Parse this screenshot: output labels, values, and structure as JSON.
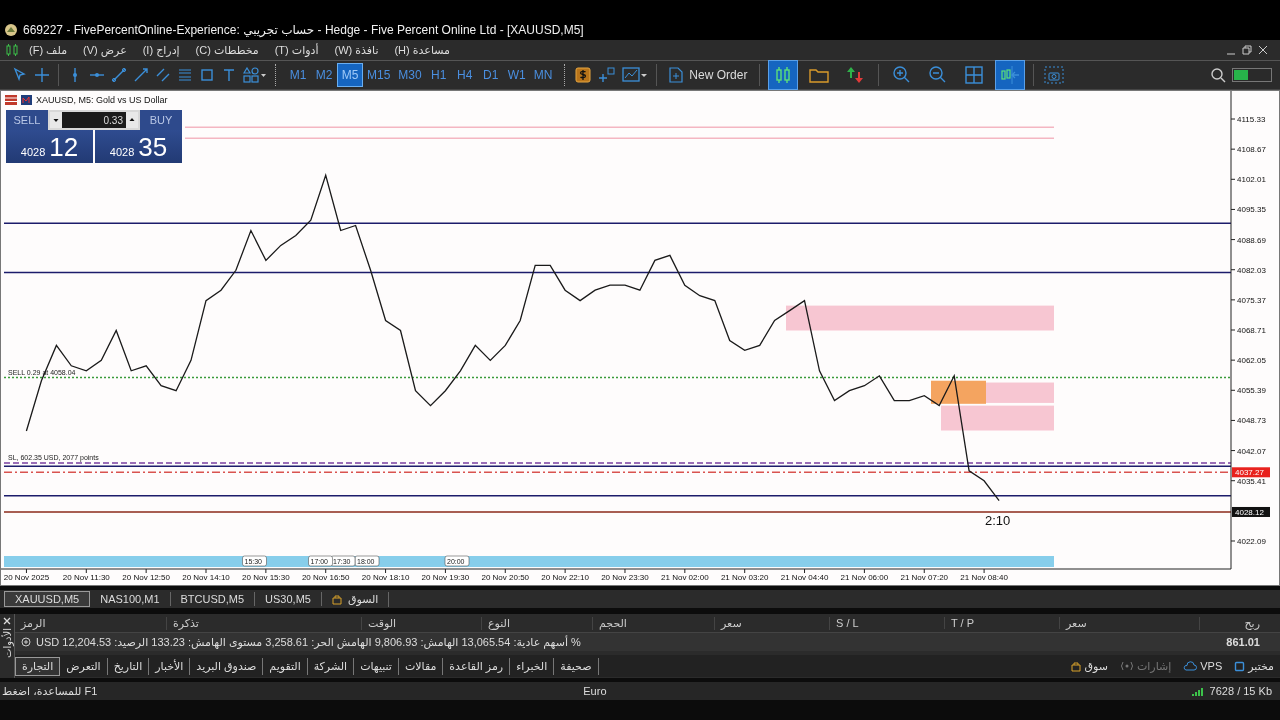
{
  "window": {
    "title": "669227 - FivePercentOnline-Experience: حساب تجريبي - Hedge - Five Percent Online Ltd - [XAUUSD,M5]"
  },
  "menu": [
    "(H) مساعدة",
    "(W) نافذة",
    "(T) أدوات",
    "(C) مخططات",
    "(I) إدراج",
    "(V) عرض",
    "(F) ملف"
  ],
  "timeframes": [
    {
      "label": "MN",
      "selected": false
    },
    {
      "label": "W1",
      "selected": false
    },
    {
      "label": "D1",
      "selected": false
    },
    {
      "label": "H4",
      "selected": false
    },
    {
      "label": "H1",
      "selected": false
    },
    {
      "label": "M30",
      "selected": false
    },
    {
      "label": "M15",
      "selected": false
    },
    {
      "label": "M5",
      "selected": true
    },
    {
      "label": "M2",
      "selected": false
    },
    {
      "label": "M1",
      "selected": false
    }
  ],
  "new_order": "New Order",
  "chart_toggles": [
    {
      "kind": "candles",
      "selected": true
    },
    {
      "kind": "folder",
      "selected": false
    },
    {
      "kind": "trade-arrows",
      "selected": false
    }
  ],
  "view_toggles": [
    {
      "kind": "zoom-in",
      "selected": false
    },
    {
      "kind": "zoom-out",
      "selected": false
    },
    {
      "kind": "tile",
      "selected": false
    },
    {
      "kind": "chart-shift",
      "selected": true
    }
  ],
  "chart": {
    "header": "XAUUSD, M5:  Gold vs US Dollar",
    "one_click": {
      "sell": "SELL",
      "buy": "BUY",
      "lot": "0.33",
      "sell_price_small": "4028",
      "sell_price_big": "12",
      "buy_price_small": "4028",
      "buy_price_big": "35"
    },
    "order_labels": [
      "SELL 0.29 at 4058.04",
      "SL, 602.35 USD, 2077 points"
    ],
    "price_tags": [
      {
        "kind": "stop",
        "text": "4037.27"
      },
      {
        "kind": "bid",
        "text": "4028.12"
      }
    ],
    "timer": "2:10",
    "sessions": [
      "20:00",
      "18:00",
      "17:30",
      "17:00",
      "15:30"
    ],
    "chart_data": {
      "type": "line",
      "ylim": [
        4015.9,
        4121.3
      ],
      "categories": [
        null,
        "20 Nov 2025",
        null,
        null,
        null,
        "20 Nov 11:30",
        null,
        null,
        null,
        "20 Nov 12:50",
        null,
        null,
        null,
        "20 Nov 14:10",
        null,
        null,
        null,
        "20 Nov 15:30",
        null,
        null,
        null,
        "20 Nov 16:50",
        null,
        null,
        null,
        "20 Nov 18:10",
        null,
        null,
        null,
        "20 Nov 19:30",
        null,
        null,
        null,
        "20 Nov 20:50",
        null,
        null,
        null,
        "20 Nov 22:10",
        null,
        null,
        null,
        "20 Nov 23:30",
        null,
        null,
        null,
        "21 Nov 02:00",
        null,
        null,
        null,
        "21 Nov 03:20",
        null,
        null,
        null,
        "21 Nov 04:40",
        null,
        null,
        null,
        "21 Nov 06:00",
        null,
        null,
        null,
        "21 Nov 07:20",
        null,
        null,
        null,
        "21 Nov 08:40",
        null,
        null,
        null,
        null,
        null,
        null,
        null,
        null,
        null,
        null,
        null,
        null,
        null,
        null,
        null,
        null
      ],
      "series": [
        {
          "color": "#1a1a1a",
          "values": [
            null,
            4046.4,
            4057.5,
            4065.3,
            4060.8,
            4059.7,
            4062.0,
            4068.6,
            4059.7,
            4060.8,
            4056.4,
            4055.3,
            4062.0,
            4075.2,
            4077.5,
            4081.9,
            4090.7,
            4084.1,
            4087.4,
            4089.6,
            4093.0,
            4102.9,
            4090.7,
            4091.8,
            4081.9,
            4070.8,
            4068.6,
            4055.3,
            4052.0,
            4055.3,
            4059.7,
            4065.3,
            4062.0,
            4065.3,
            4070.8,
            4083.0,
            4083.0,
            4077.5,
            4075.2,
            4077.5,
            4078.6,
            4078.6,
            4077.5,
            4084.1,
            4085.2,
            4078.6,
            4076.3,
            4075.2,
            4066.4,
            4064.2,
            4065.3,
            4070.8,
            4073.0,
            4075.2,
            4059.7,
            4053.1,
            4055.3,
            4056.4,
            4058.6,
            4053.1,
            4053.1,
            4054.2,
            4052.0,
            4058.6,
            4037.6,
            4035.4,
            4031.0,
            null,
            null,
            null,
            null,
            null,
            null,
            null,
            null,
            null,
            null,
            null,
            null,
            null,
            null,
            null
          ]
        }
      ],
      "yticks": [
        4115.33,
        4108.67,
        4102.01,
        4095.35,
        4088.69,
        4082.03,
        4075.37,
        4068.71,
        4062.05,
        4055.39,
        4048.73,
        4042.07,
        4035.41,
        4022.09
      ]
    }
  },
  "chart_tabs": [
    {
      "label": "السوق",
      "selected": false
    },
    {
      "label": "US30,M5",
      "selected": false
    },
    {
      "label": "BTCUSD,M5",
      "selected": false
    },
    {
      "label": "NAS100,M1",
      "selected": false
    },
    {
      "label": "XAUUSD,M5",
      "selected": true
    }
  ],
  "terminal": {
    "toolbox_label": "الأدوات",
    "columns": [
      "ربح",
      "سعر",
      "T / P",
      "S / L",
      "سعر",
      "الحجم",
      "النوع",
      "الوقت",
      "تذكرة",
      "الرمز"
    ],
    "summary": "% أسهم عادية: 13,065.54  الهامش: 9,806.93  الهامش الحر: 3,258.61  مستوى الهامش: 133.23  الرصيد: 12,204.53 USD",
    "profit": "861.01",
    "tabs": [
      {
        "label": "صحيفة",
        "selected": false
      },
      {
        "label": "الخبراء",
        "selected": false
      },
      {
        "label": "رمز القاعدة",
        "selected": false
      },
      {
        "label": "مقالات",
        "selected": false
      },
      {
        "label": "تنبيهات",
        "selected": false
      },
      {
        "label": "الشركة",
        "selected": false
      },
      {
        "label": "التقويم",
        "selected": false
      },
      {
        "label": "صندوق البريد",
        "selected": false
      },
      {
        "label": "الأخبار",
        "selected": false
      },
      {
        "label": "التاريخ",
        "selected": false
      },
      {
        "label": "التعرض",
        "selected": false
      },
      {
        "label": "التجارة",
        "selected": true
      }
    ],
    "right_tabs": [
      {
        "kind": "tester",
        "label": "مختبر",
        "disabled": false
      },
      {
        "kind": "vps",
        "label": "VPS",
        "disabled": false
      },
      {
        "kind": "signals",
        "label": "إشارات",
        "disabled": true
      },
      {
        "kind": "market",
        "label": "سوق",
        "disabled": false
      }
    ]
  },
  "status_bar": {
    "help": "للمساعدة، اضغط F1",
    "profile": "Euro",
    "traffic": "7628 / 15 Kb"
  }
}
